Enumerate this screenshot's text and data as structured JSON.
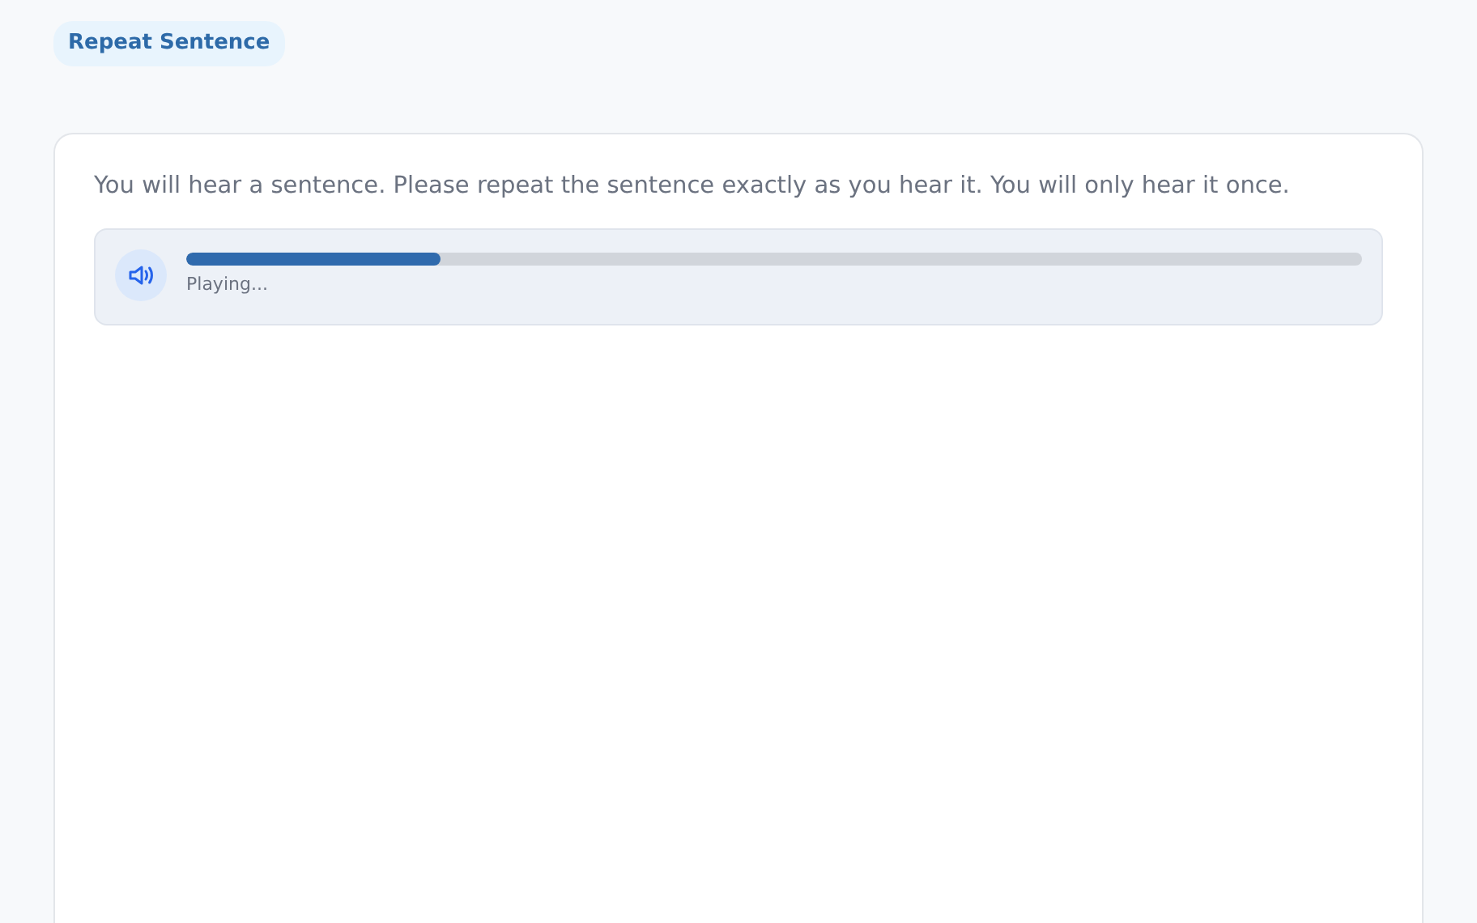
{
  "tag": "Repeat Sentence",
  "instruction": "You will hear a sentence. Please repeat the sentence exactly as you hear it. You will only hear it once.",
  "player": {
    "level": 0.216,
    "status": "Playing..."
  }
}
